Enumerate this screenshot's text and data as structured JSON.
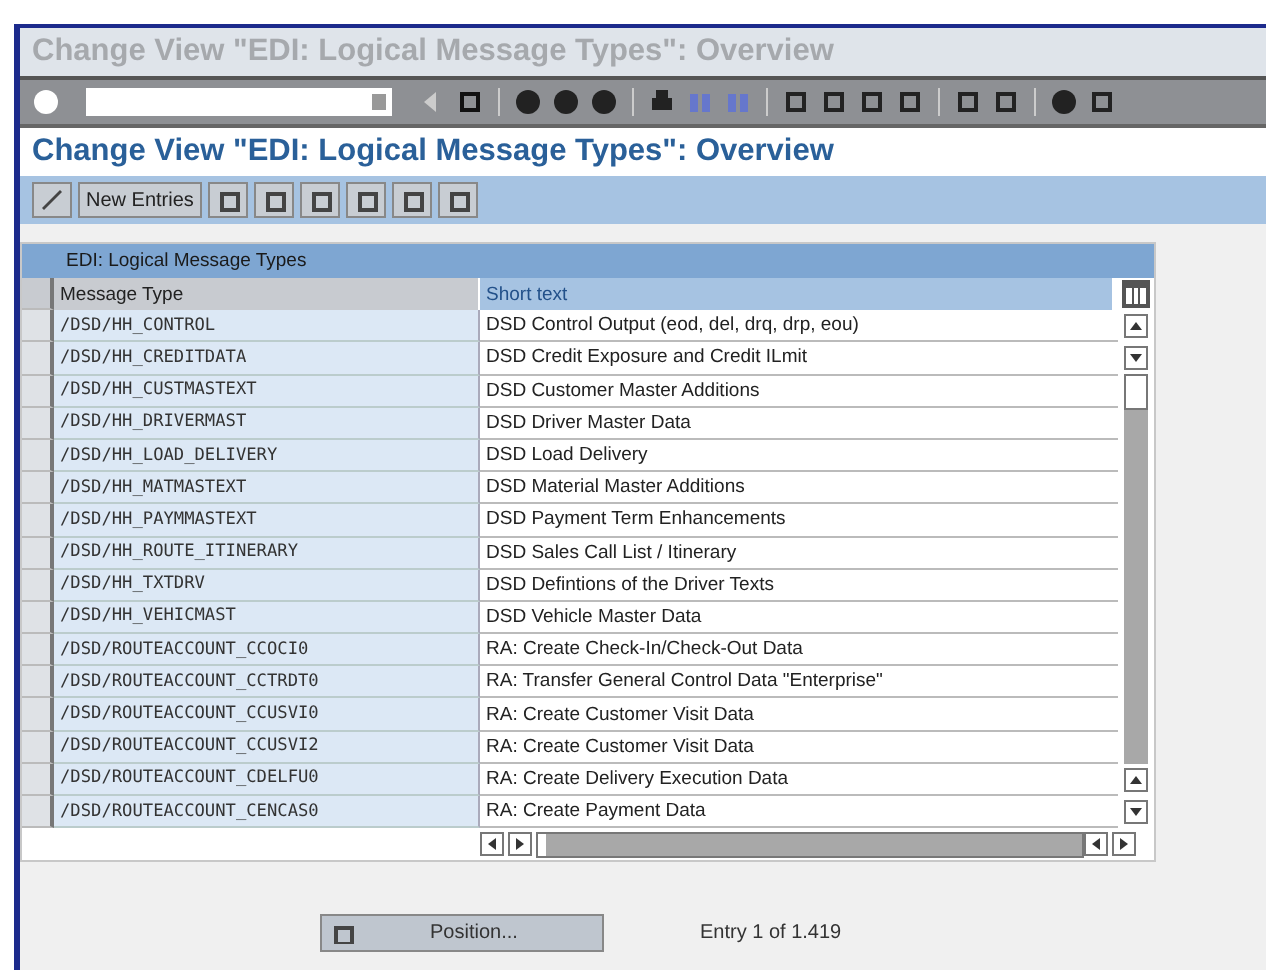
{
  "window": {
    "title": "Change View \"EDI: Logical Message Types\": Overview"
  },
  "page_title": "Change View \"EDI: Logical Message Types\": Overview",
  "app_toolbar": {
    "new_entries": "New Entries"
  },
  "table": {
    "title": "EDI: Logical Message Types",
    "columns": [
      "Message Type",
      "Short text"
    ],
    "rows": [
      {
        "message_type": "/DSD/HH_CONTROL",
        "short_text": "DSD Control Output (eod, del, drq, drp, eou)"
      },
      {
        "message_type": "/DSD/HH_CREDITDATA",
        "short_text": "DSD Credit Exposure and Credit ILmit"
      },
      {
        "message_type": "/DSD/HH_CUSTMASTEXT",
        "short_text": "DSD Customer Master Additions"
      },
      {
        "message_type": "/DSD/HH_DRIVERMAST",
        "short_text": "DSD Driver Master Data"
      },
      {
        "message_type": "/DSD/HH_LOAD_DELIVERY",
        "short_text": "DSD Load Delivery"
      },
      {
        "message_type": "/DSD/HH_MATMASTEXT",
        "short_text": "DSD Material Master Additions"
      },
      {
        "message_type": "/DSD/HH_PAYMMASTEXT",
        "short_text": "DSD Payment Term Enhancements"
      },
      {
        "message_type": "/DSD/HH_ROUTE_ITINERARY",
        "short_text": "DSD Sales Call List / Itinerary"
      },
      {
        "message_type": "/DSD/HH_TXTDRV",
        "short_text": "DSD Defintions of the Driver Texts"
      },
      {
        "message_type": "/DSD/HH_VEHICMAST",
        "short_text": "DSD Vehicle Master Data"
      },
      {
        "message_type": "/DSD/ROUTEACCOUNT_CCOCI0",
        "short_text": "RA: Create Check-In/Check-Out Data"
      },
      {
        "message_type": "/DSD/ROUTEACCOUNT_CCTRDT0",
        "short_text": "RA: Transfer General Control Data \"Enterprise\""
      },
      {
        "message_type": "/DSD/ROUTEACCOUNT_CCUSVI0",
        "short_text": "RA: Create Customer Visit Data"
      },
      {
        "message_type": "/DSD/ROUTEACCOUNT_CCUSVI2",
        "short_text": "RA: Create Customer Visit Data"
      },
      {
        "message_type": "/DSD/ROUTEACCOUNT_CDELFU0",
        "short_text": "RA: Create Delivery Execution Data"
      },
      {
        "message_type": "/DSD/ROUTEACCOUNT_CENCAS0",
        "short_text": "RA: Create Payment Data"
      }
    ]
  },
  "position_button": "Position...",
  "entry_info": "Entry 1 of 1.419"
}
